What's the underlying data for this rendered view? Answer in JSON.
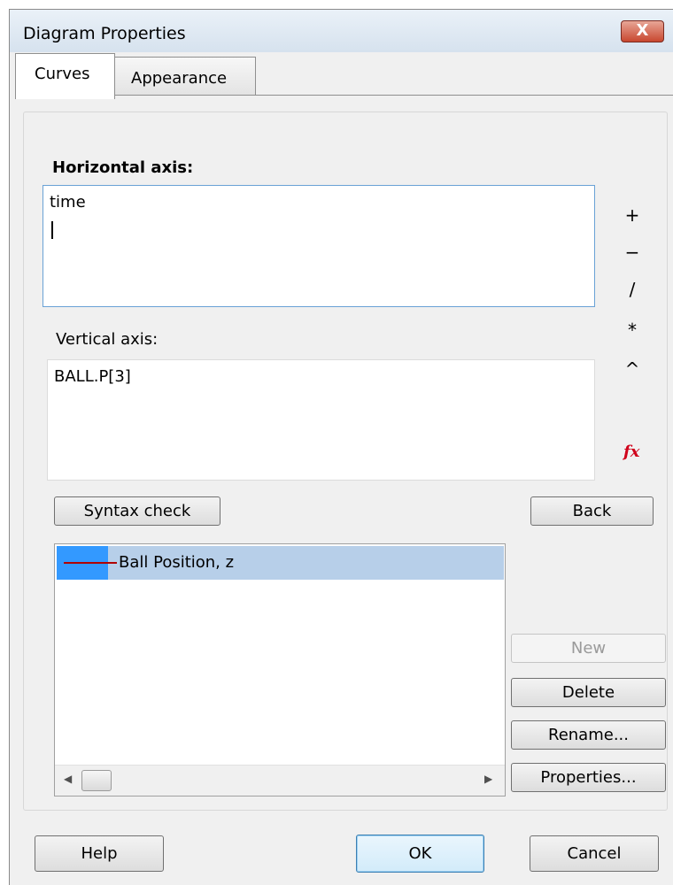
{
  "window": {
    "title": "Diagram Properties",
    "close_label": "X"
  },
  "tabs": [
    {
      "label": "Curves",
      "active": true
    },
    {
      "label": "Appearance",
      "active": false
    }
  ],
  "horizontal_axis": {
    "label": "Horizontal axis:",
    "value": "time"
  },
  "vertical_axis": {
    "label": "Vertical axis:",
    "value": "BALL.P[3]"
  },
  "operators": [
    "+",
    "−",
    "/",
    "*",
    "^"
  ],
  "function_icon": "fx",
  "buttons": {
    "syntax_check": "Syntax check",
    "back": "Back",
    "new": "New",
    "delete": "Delete",
    "rename": "Rename...",
    "properties": "Properties...",
    "help": "Help",
    "ok": "OK",
    "cancel": "Cancel"
  },
  "curves": [
    {
      "label": "Ball Position, z",
      "color": "#b00000",
      "selected": true
    }
  ],
  "colors": {
    "selection": "#b7cfe9",
    "swatch_bg": "#3399ff",
    "fx": "#d0021b",
    "close_button": "#c8472f"
  }
}
